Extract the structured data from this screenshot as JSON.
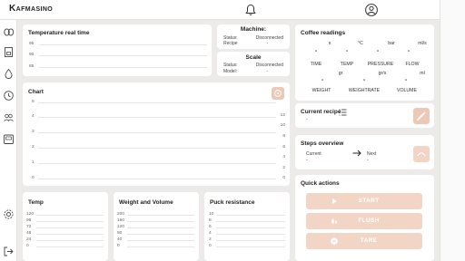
{
  "app": {
    "brand": "Kafmasino"
  },
  "temperature_card": {
    "title": "Temperature real time",
    "ticks": [
      "95",
      "90",
      "85"
    ]
  },
  "machine": {
    "title": "Machine:",
    "status_label": "Status:",
    "status_value": "Disconnected",
    "recipe_label": "Recipe",
    "recipe_value": "-"
  },
  "scale": {
    "title": "Scale",
    "status_label": "Status:",
    "status_value": "Disconnected",
    "model_label": "Model:",
    "model_value": "-"
  },
  "coffee": {
    "title": "Coffee readings",
    "row1_units": [
      "s",
      "°C",
      "bar",
      "ml/s"
    ],
    "row1_values": [
      "-",
      "-",
      "-",
      "-"
    ],
    "row1_labels": [
      "TIME",
      "TEMP",
      "PRESSURE",
      "FLOW"
    ],
    "row2_units": [
      "gr",
      "gr/s",
      "ml"
    ],
    "row2_values": [
      "-",
      "-",
      "-"
    ],
    "row2_labels": [
      "WEIGHT",
      "WEIGHTRATE",
      "VOLUME"
    ]
  },
  "chart": {
    "title": "Chart",
    "left_ticks": [
      "5",
      "4",
      "3",
      "2",
      "1",
      "0"
    ],
    "right_ticks": [
      "12",
      "10",
      "8",
      "6",
      "4",
      "2",
      "0"
    ]
  },
  "current_recipe": {
    "title": "Current recipe",
    "value": "-"
  },
  "steps": {
    "title": "Steps overview",
    "current_label": "Current",
    "current_value": "-",
    "next_label": "Next",
    "next_value": "-"
  },
  "temp_chart": {
    "title": "Temp",
    "ticks": [
      "120",
      "96",
      "72",
      "48",
      "24",
      "0"
    ]
  },
  "weight_chart": {
    "title": "Weight and Volume",
    "ticks": [
      "200",
      "160",
      "120",
      "80",
      "40",
      "0"
    ]
  },
  "puck_chart": {
    "title": "Puck resistance",
    "ticks": [
      "10",
      "8",
      "6",
      "4",
      "2",
      "0"
    ]
  },
  "quick_actions": {
    "title": "Quick actions",
    "start": "START",
    "flush": "FLUSH",
    "tare": "TARE"
  },
  "colors": {
    "accent": "#f3d5c6",
    "accent_strong": "#ecc9b6",
    "background": "#ecebea"
  }
}
